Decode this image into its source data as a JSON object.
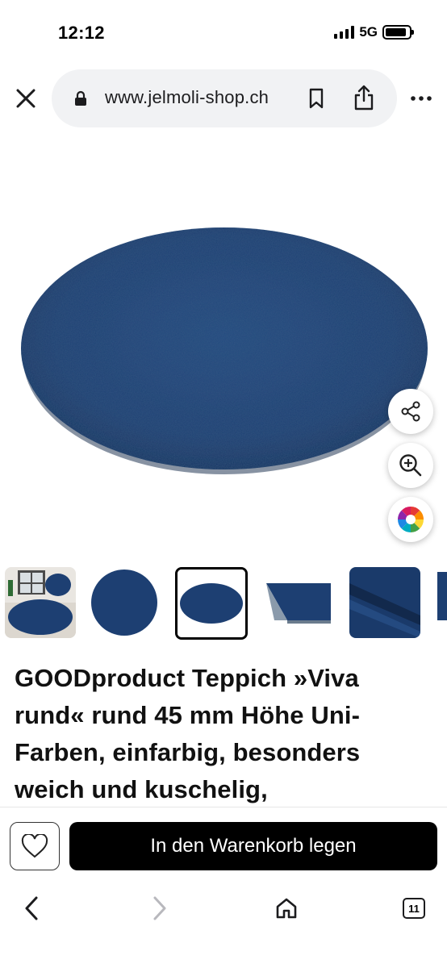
{
  "status_bar": {
    "time": "12:12",
    "network": "5G",
    "battery_level": 0.9
  },
  "browser": {
    "url": "www.jelmoli-shop.ch",
    "icons": {
      "close": "close-icon",
      "lock": "lock-icon",
      "bookmark": "bookmark-icon",
      "share": "share-icon",
      "more": "more-icon"
    }
  },
  "product_image": {
    "rug_color": "#1d3f72",
    "actions": [
      "share-icon",
      "zoom-in-icon",
      "color-wheel-icon"
    ]
  },
  "thumbnails": {
    "items": [
      "room-scene",
      "round-rug-top",
      "oval-rug",
      "rug-corner",
      "rug-closeup",
      "rug-partial"
    ],
    "selected_index": 2
  },
  "product": {
    "title": "GOODproduct Teppich »Viva rund« rund 45 mm Höhe Uni-Farben, einfarbig, besonders weich und kuschelig,"
  },
  "actions": {
    "add_to_cart_label": "In den Warenkorb legen",
    "wishlist_icon": "heart-icon"
  },
  "browser_nav": {
    "tabs_count": "11",
    "icons": [
      "back-icon",
      "forward-icon",
      "home-icon",
      "tabs-icon"
    ]
  },
  "colors": {
    "accent": "#000000",
    "rug": "#1d3f72",
    "pill_bg": "#f1f2f4"
  }
}
